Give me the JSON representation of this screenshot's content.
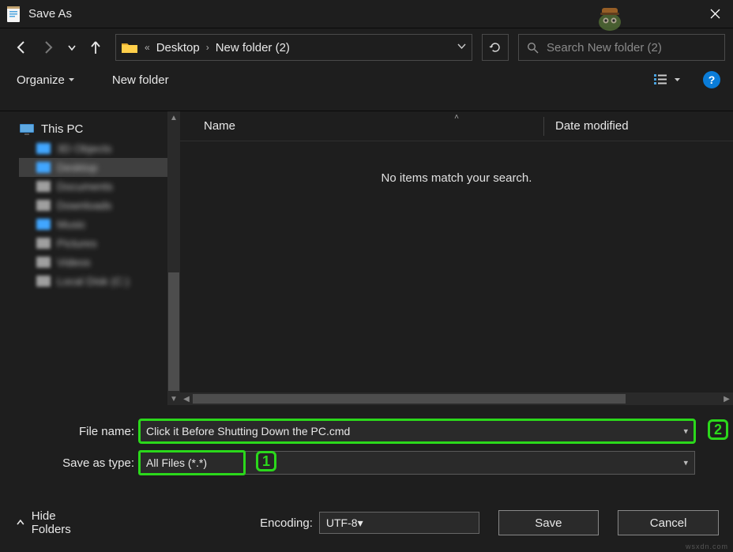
{
  "window": {
    "title": "Save As"
  },
  "breadcrumb": {
    "items": [
      {
        "label": "Desktop"
      },
      {
        "label": "New folder (2)"
      }
    ]
  },
  "search": {
    "placeholder": "Search New folder (2)"
  },
  "toolbar": {
    "organize": "Organize",
    "new_folder": "New folder"
  },
  "navpane": {
    "root": "This PC",
    "items": [
      {
        "label": "3D Objects",
        "sel": false,
        "blue": true
      },
      {
        "label": "Desktop",
        "sel": true,
        "blue": true
      },
      {
        "label": "Documents",
        "sel": false,
        "blue": false
      },
      {
        "label": "Downloads",
        "sel": false,
        "blue": false
      },
      {
        "label": "Music",
        "sel": false,
        "blue": true
      },
      {
        "label": "Pictures",
        "sel": false,
        "blue": false
      },
      {
        "label": "Videos",
        "sel": false,
        "blue": false
      },
      {
        "label": "Local Disk (C:)",
        "sel": false,
        "blue": false
      }
    ]
  },
  "filelist": {
    "col_name": "Name",
    "col_date": "Date modified",
    "empty": "No items match your search."
  },
  "form": {
    "filename_label": "File name:",
    "filename_value": "Click it Before Shutting Down the PC.cmd",
    "type_label": "Save as type:",
    "type_value": "All Files  (*.*)",
    "encoding_label": "Encoding:",
    "encoding_value": "UTF-8",
    "hide_folders": "Hide Folders",
    "save": "Save",
    "cancel": "Cancel"
  },
  "annotations": {
    "badge1": "1",
    "badge2": "2"
  },
  "watermark": "wsxdn.com"
}
